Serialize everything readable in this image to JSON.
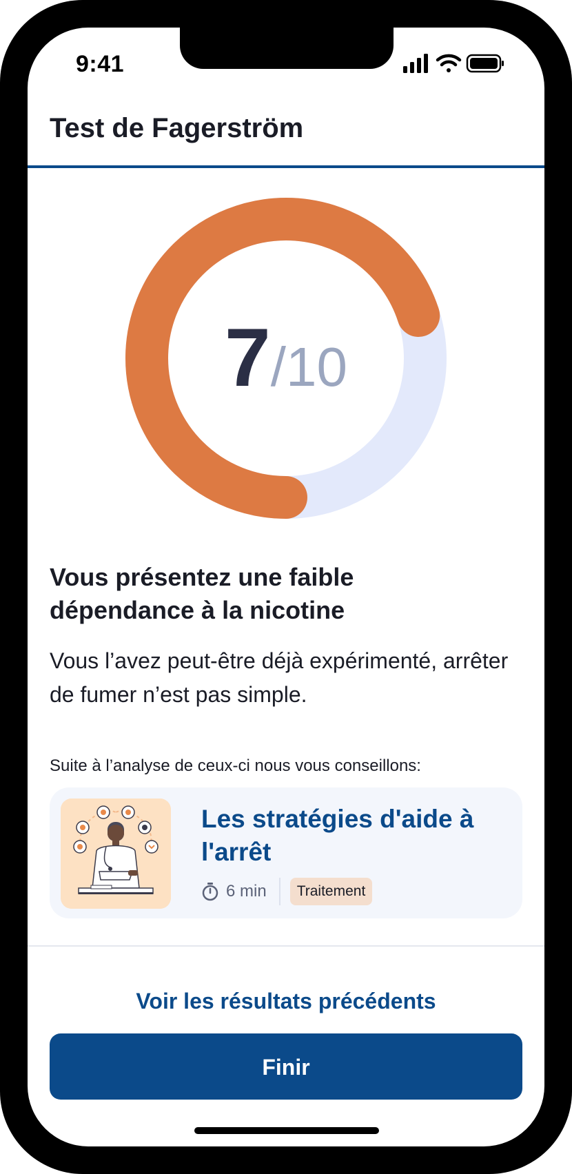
{
  "status_bar": {
    "time": "9:41",
    "icons": [
      "cellular-signal-icon",
      "wifi-icon",
      "battery-icon"
    ]
  },
  "header": {
    "title": "Test de Fagerström"
  },
  "score": {
    "value": "7",
    "total": "/10",
    "fraction": 0.7
  },
  "result": {
    "title": "Vous présentez une faible dépendance à la nicotine",
    "description": "Vous l’avez peut-être déjà expérimenté, arrêter de fumer n’est pas simple."
  },
  "advice": {
    "intro": "Suite à l’analyse de ceux-ci nous vous conseillons:",
    "card": {
      "title": "Les stratégies d'aide à l'arrêt",
      "duration": "6 min",
      "tag": "Traitement",
      "icon": "timer-icon"
    }
  },
  "footer": {
    "previous_results_label": "Voir les résultats précédents",
    "finish_label": "Finir"
  },
  "colors": {
    "accent": "#0b4a8a",
    "gauge_fill": "#dd7a43",
    "gauge_track": "#e3e9fb",
    "tag_background": "#f4dece"
  }
}
